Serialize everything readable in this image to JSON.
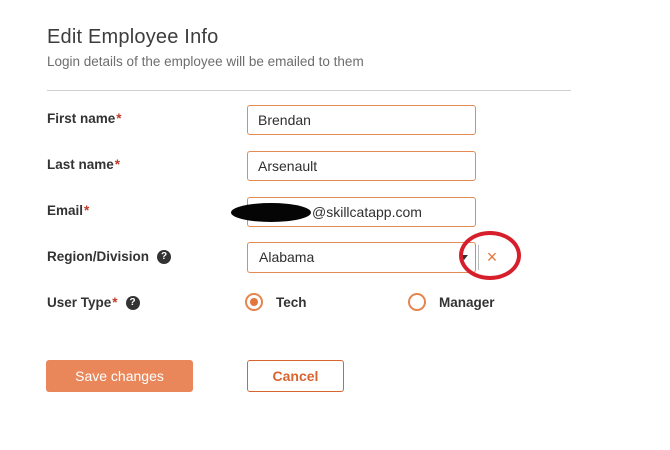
{
  "header": {
    "title": "Edit Employee Info",
    "subtitle": "Login details of the employee will be emailed to them"
  },
  "form": {
    "first_name": {
      "label": "First name",
      "value": "Brendan"
    },
    "last_name": {
      "label": "Last name",
      "value": "Arsenault"
    },
    "email": {
      "label": "Email",
      "value_visible": "@skillcatapp.com"
    },
    "region": {
      "label": "Region/Division",
      "value": "Alabama"
    },
    "user_type": {
      "label": "User Type",
      "options": [
        "Tech",
        "Manager"
      ],
      "selected": "Tech"
    },
    "required_marker": "*",
    "help_glyph": "?"
  },
  "actions": {
    "save_label": "Save changes",
    "cancel_label": "Cancel"
  },
  "icons": {
    "clear": "×"
  },
  "colors": {
    "accent": "#e4753c",
    "annotation": "#d61f2a",
    "required": "#c0392b"
  }
}
